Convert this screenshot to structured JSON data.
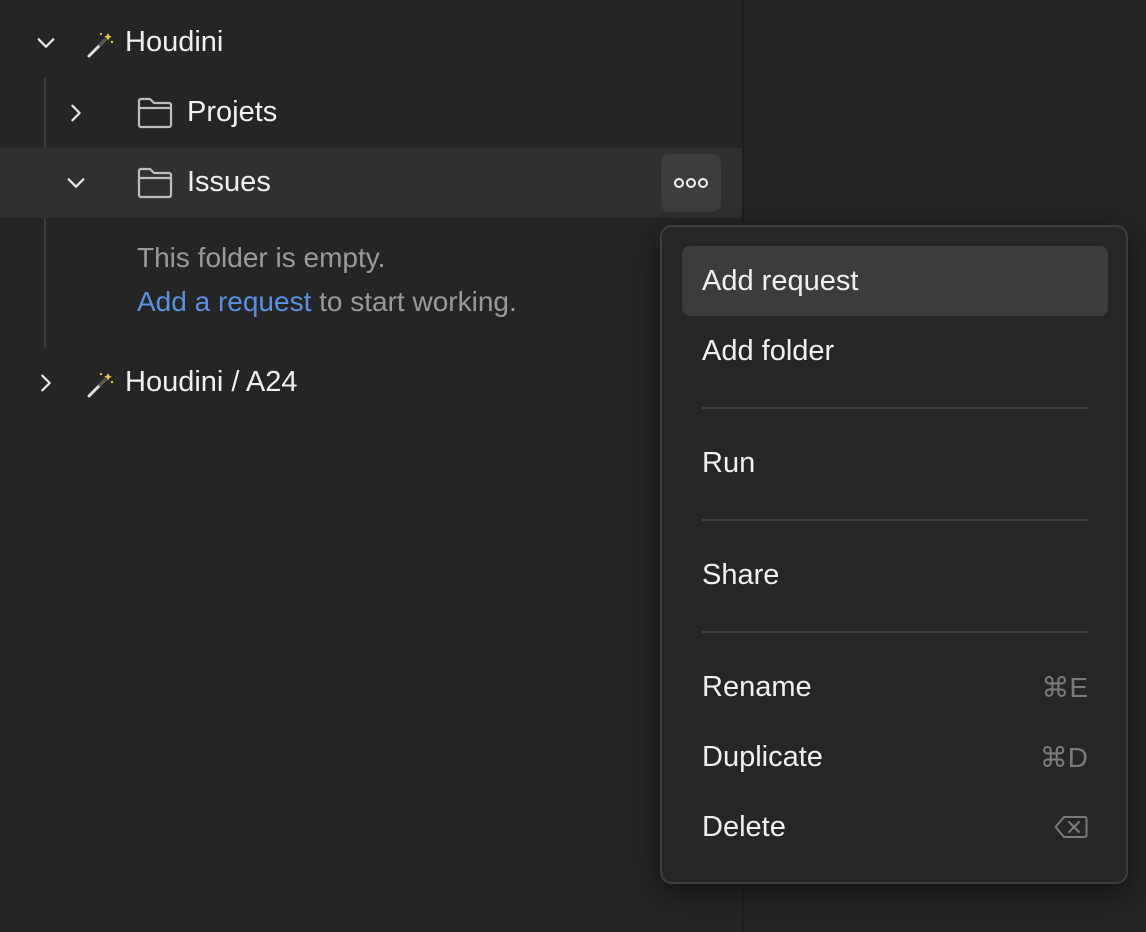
{
  "tree": {
    "root1": {
      "label": "Houdini",
      "expanded": true
    },
    "folders": [
      {
        "label": "Projets",
        "expanded": false
      },
      {
        "label": "Issues",
        "expanded": true
      }
    ],
    "empty": {
      "line1": "This folder is empty.",
      "link": "Add a request",
      "line2_rest": " to start working."
    },
    "root2": {
      "label": "Houdini / A24",
      "expanded": false
    }
  },
  "menu": {
    "add_request": "Add request",
    "add_folder": "Add folder",
    "run": "Run",
    "share": "Share",
    "rename": "Rename",
    "rename_shortcut": "⌘E",
    "duplicate": "Duplicate",
    "duplicate_shortcut": "⌘D",
    "delete": "Delete"
  },
  "colors": {
    "background": "#242424",
    "link": "#5b8fe0",
    "menu_hover": "#3c3c3c"
  }
}
